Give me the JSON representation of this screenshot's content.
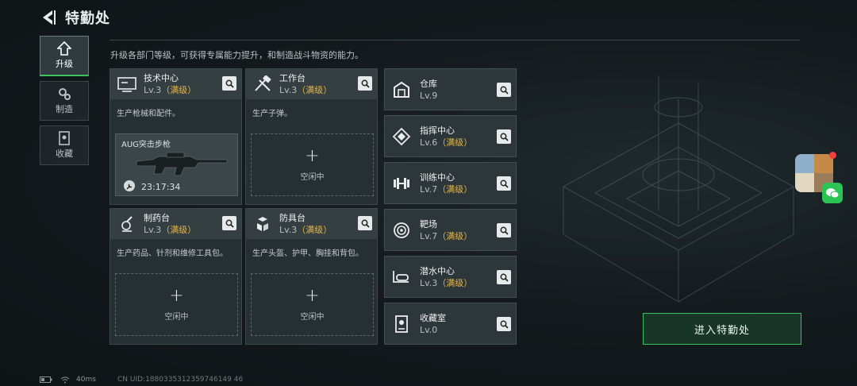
{
  "header": {
    "title": "特勤处",
    "description": "升级各部门等级，可获得专属能力提升，和制造战斗物资的能力。"
  },
  "sidenav": [
    {
      "label": "升级",
      "icon": "upgrade-icon",
      "active": true
    },
    {
      "label": "制造",
      "icon": "gears-icon",
      "active": false
    },
    {
      "label": "收藏",
      "icon": "collection-icon",
      "active": false
    }
  ],
  "workshops": [
    {
      "name": "技术中心",
      "level": "Lv.3",
      "max": "（满级）",
      "icon": "tech-center-icon",
      "desc": "生产枪械和配件。",
      "slot": {
        "status": "busy",
        "item": "AUG突击步枪",
        "timer": "23:17:34"
      }
    },
    {
      "name": "工作台",
      "level": "Lv.3",
      "max": "（满级）",
      "icon": "workbench-icon",
      "desc": "生产子弹。",
      "slot": {
        "status": "idle",
        "label": "空闲中"
      }
    },
    {
      "name": "制药台",
      "level": "Lv.3",
      "max": "（满级）",
      "icon": "pharmacy-icon",
      "desc": "生产药品、针剂和维修工具包。",
      "slot": {
        "status": "idle",
        "label": "空闲中"
      }
    },
    {
      "name": "防具台",
      "level": "Lv.3",
      "max": "（满级）",
      "icon": "armor-bench-icon",
      "desc": "生产头盔、护甲、胸挂和背包。",
      "slot": {
        "status": "idle",
        "label": "空闲中"
      }
    }
  ],
  "facilities": [
    {
      "name": "仓库",
      "level": "Lv.9",
      "max": "",
      "icon": "warehouse-icon"
    },
    {
      "name": "指挥中心",
      "level": "Lv.6",
      "max": "（满级）",
      "icon": "command-center-icon"
    },
    {
      "name": "训练中心",
      "level": "Lv.7",
      "max": "（满级）",
      "icon": "training-center-icon"
    },
    {
      "name": "靶场",
      "level": "Lv.7",
      "max": "（满级）",
      "icon": "shooting-range-icon"
    },
    {
      "name": "潜水中心",
      "level": "Lv.3",
      "max": "（满级）",
      "icon": "diving-center-icon"
    },
    {
      "name": "收藏室",
      "level": "Lv.0",
      "max": "",
      "icon": "collection-room-icon"
    }
  ],
  "enter_button": "进入特勤处",
  "status_bar": {
    "ping": "40ms",
    "uid": "CN UID:1880335312359746149 46"
  },
  "colors": {
    "accent_green": "#37c35a",
    "max_level": "#e3b54a",
    "panel": "#263033"
  }
}
